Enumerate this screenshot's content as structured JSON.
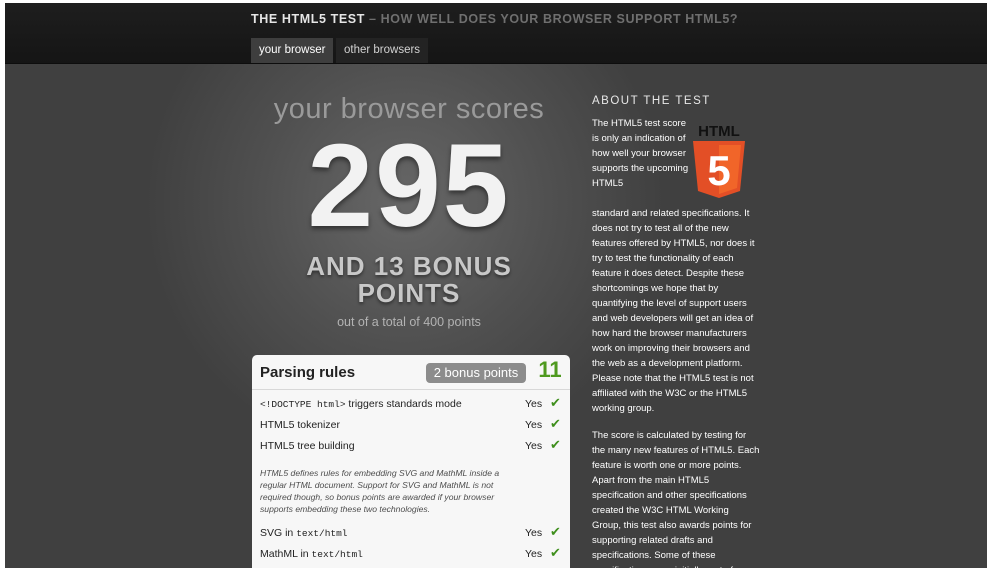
{
  "header": {
    "title": "THE HTML5 TEST",
    "subtitle": "– HOW WELL DOES YOUR BROWSER SUPPORT HTML5?"
  },
  "tabs": [
    {
      "label": "your browser"
    },
    {
      "label": "other browsers"
    }
  ],
  "scoreboard": {
    "heading": "your browser scores",
    "score": "295",
    "bonus_line1": "AND 13 BONUS",
    "bonus_line2": "POINTS",
    "total": "out of a total of 400 points"
  },
  "parsing": {
    "title": "Parsing rules",
    "bonus_badge": "2 bonus points",
    "section_score": "11",
    "rows": [
      {
        "code": "<!DOCTYPE html>",
        "text": " triggers standards mode",
        "result": "Yes"
      },
      {
        "text": "HTML5 tokenizer",
        "result": "Yes"
      },
      {
        "text": "HTML5 tree building",
        "result": "Yes"
      }
    ],
    "note": "HTML5 defines rules for embedding SVG and MathML inside a regular HTML document. Support for SVG and MathML is not required though, so bonus points are awarded if your browser supports embedding these two technologies.",
    "bonus_rows": [
      {
        "text": "SVG in ",
        "code": "text/html",
        "result": "Yes"
      },
      {
        "text": "MathML in ",
        "code": "text/html",
        "result": "Yes"
      }
    ]
  },
  "about": {
    "heading": "ABOUT THE TEST",
    "logo_text": "HTML",
    "logo_glyph": "5",
    "p1_start": "The HTML5 test score is only an indication of how well your browser supports the upcoming HTML5",
    "p1_rest": "standard and related specifications. It does not try to test all of the new features offered by HTML5, nor does it try to test the functionality of each feature it does detect. Despite these shortcomings we hope that by quantifying the level of support users and web developers will get an idea of how hard the browser manufacturers work on improving their browsers and the web as a development platform. Please note that the HTML5 test is not affiliated with the W3C or the HTML5 working group.",
    "p2": "The score is calculated by testing for the many new features of HTML5. Each feature is worth one or more points. Apart from the main HTML5 specification and other specifications created the W3C HTML Working Group, this test also awards points for supporting related drafts and specifications. Some of these specifications were initially part of"
  },
  "colors": {
    "accent_green": "#4f9a1f",
    "check_green": "#3f8f1d",
    "html5_orange": "#e34f26",
    "badge_gray": "#8c8c8c"
  },
  "icons": {
    "check": "checkmark-icon",
    "logo": "html5-shield-logo"
  }
}
